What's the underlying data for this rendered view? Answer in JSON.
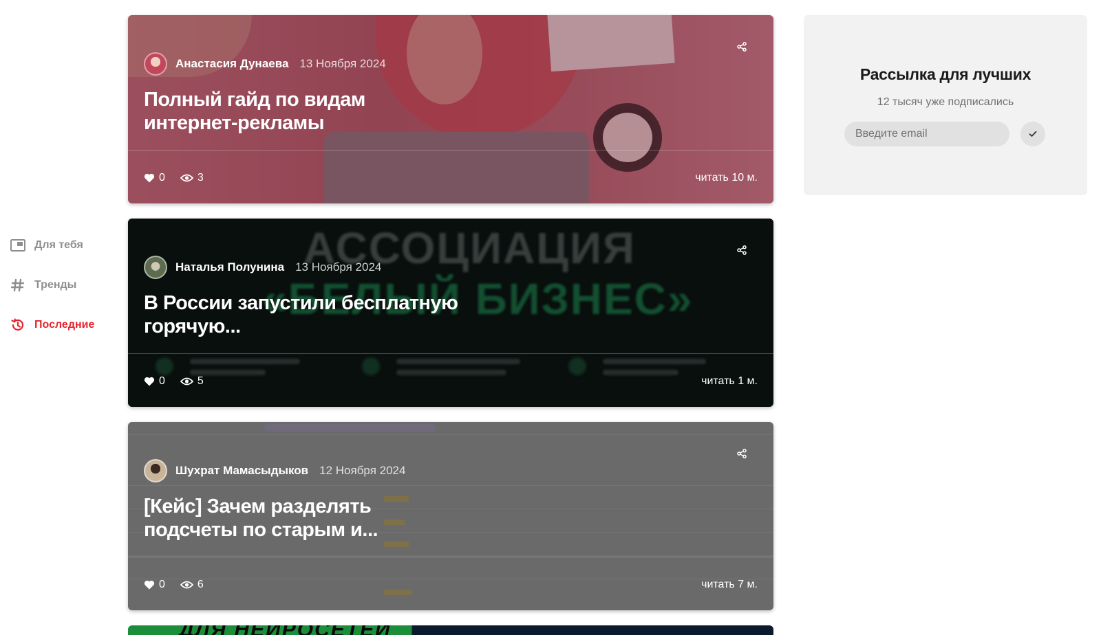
{
  "nav": {
    "items": [
      {
        "label": "Для тебя",
        "icon": "picture-in-picture-icon",
        "active": false
      },
      {
        "label": "Тренды",
        "icon": "hashtag-icon",
        "active": false
      },
      {
        "label": "Последние",
        "icon": "history-icon",
        "active": true
      }
    ]
  },
  "colors": {
    "accent": "#e8222c",
    "nav_inactive": "#8e8e8e",
    "widget_bg": "#f2f2f2"
  },
  "feed": {
    "cards": [
      {
        "author": "Анастасия Дунаева",
        "date": "13 Ноября 2024",
        "title": "Полный гайд по видам интернет-рекламы",
        "likes": "0",
        "views": "3",
        "read_time": "читать 10 м."
      },
      {
        "author": "Наталья Полунина",
        "date": "13 Ноября 2024",
        "title": "В России запустили бесплатную горячую...",
        "likes": "0",
        "views": "5",
        "read_time": "читать 1 м.",
        "image_text_1": "АССОЦИАЦИЯ",
        "image_text_2": "«БЕЛЫЙ БИЗНЕС»"
      },
      {
        "author": "Шухрат Мамасыдыков",
        "date": "12 Ноября 2024",
        "title": "[Кейс] Зачем разделять подсчеты по старым и...",
        "likes": "0",
        "views": "6",
        "read_time": "читать 7 м."
      },
      {
        "image_text": "ДЛЯ НЕЙРОСЕТЕЙ"
      }
    ]
  },
  "subscribe": {
    "title": "Рассылка для лучших",
    "count": "12 тысяч уже подписались",
    "email_placeholder": "Введите email"
  }
}
